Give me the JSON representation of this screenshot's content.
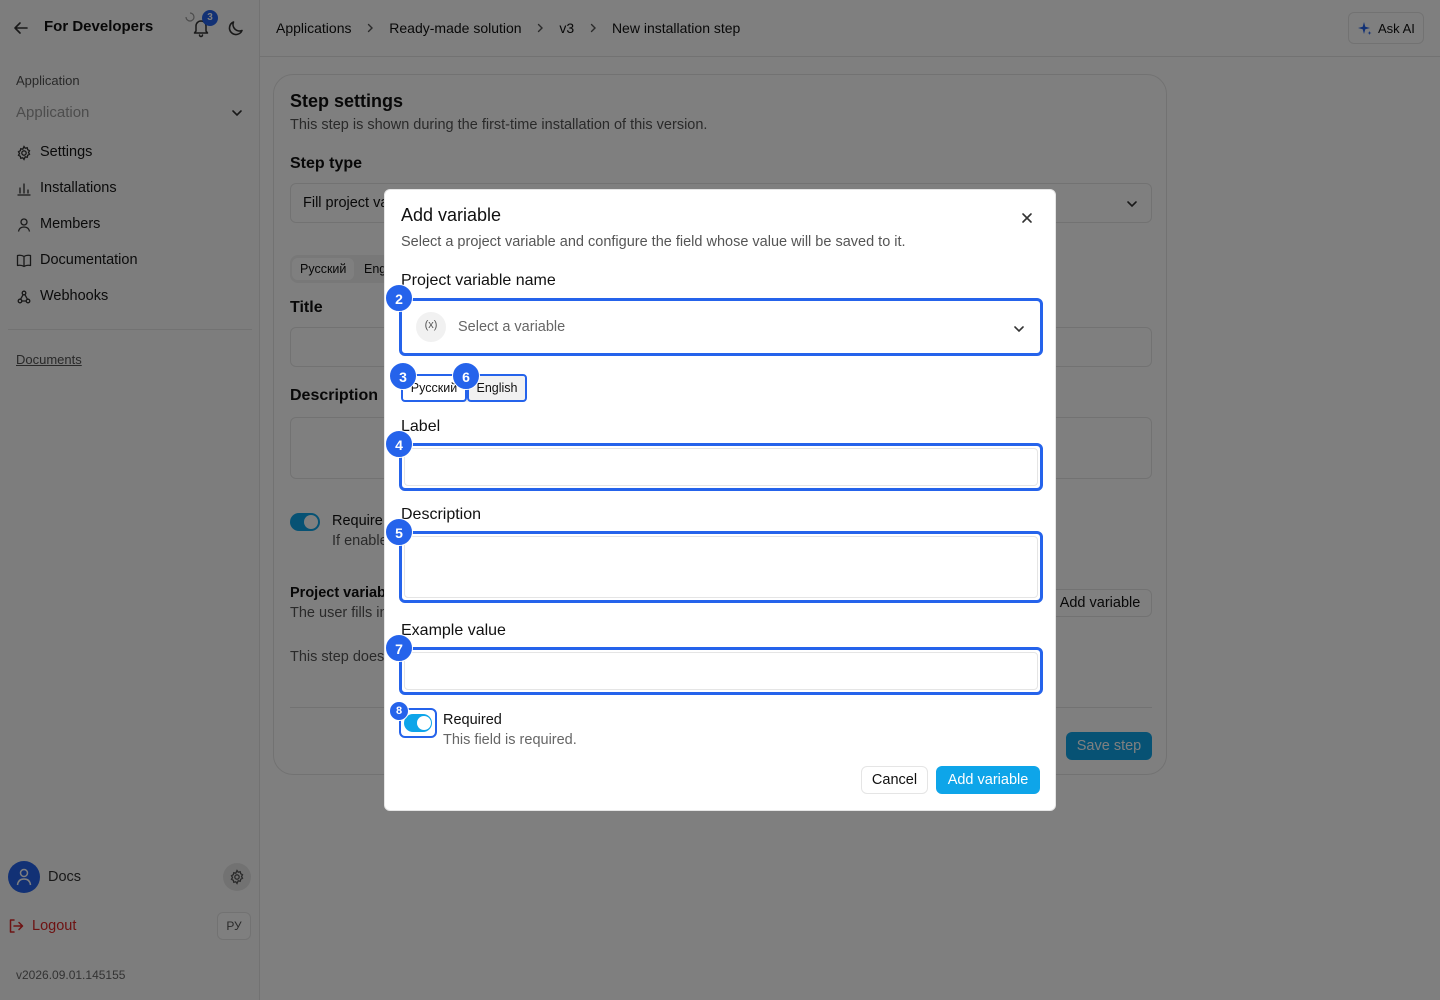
{
  "sidebar": {
    "brand": "For Developers",
    "notification_count": "3",
    "section_label": "Application",
    "app_select_placeholder": "Application",
    "nav": [
      {
        "label": "Settings",
        "icon": "gear-icon"
      },
      {
        "label": "Installations",
        "icon": "bar-chart-icon"
      },
      {
        "label": "Members",
        "icon": "user-icon"
      },
      {
        "label": "Documentation",
        "icon": "book-icon"
      },
      {
        "label": "Webhooks",
        "icon": "webhook-icon"
      }
    ],
    "documents_link": "Documents",
    "user_name": "Docs",
    "logout_label": "Logout",
    "lang_button": "РУ",
    "version": "v2026.09.01.145155"
  },
  "header": {
    "breadcrumbs": [
      "Applications",
      "Ready-made solution",
      "v3",
      "New installation step"
    ],
    "ask_ai": "Ask AI"
  },
  "card": {
    "title": "Step settings",
    "subtitle": "This step is shown during the first-time installation of this version.",
    "step_type_label": "Step type",
    "step_type_value": "Fill project va",
    "tabs": [
      "Русский",
      "Eng"
    ],
    "title_label": "Title",
    "description_label": "Description",
    "required_label": "Require",
    "required_desc": "If enable",
    "project_vars_label": "Project variab",
    "project_vars_desc": "The user fills in",
    "add_variable": "Add variable",
    "empty_text": "This step does",
    "save_step": "Save step"
  },
  "modal": {
    "title": "Add variable",
    "subtitle": "Select a project variable and configure the field whose value will be saved to it.",
    "var_name_label": "Project variable name",
    "var_select_placeholder": "Select a variable",
    "var_icon_text": "(x)",
    "tabs": [
      "Русский",
      "English"
    ],
    "label_label": "Label",
    "description_label": "Description",
    "example_label": "Example value",
    "required_label": "Required",
    "required_desc": "This field is required.",
    "cancel": "Cancel",
    "submit": "Add variable",
    "label_value": "",
    "description_value": "",
    "example_value": ""
  },
  "markers": [
    "2",
    "3",
    "6",
    "4",
    "5",
    "7",
    "8"
  ],
  "colors": {
    "accent": "#0ea5e9",
    "marker": "#2563eb",
    "danger": "#dc2626"
  }
}
